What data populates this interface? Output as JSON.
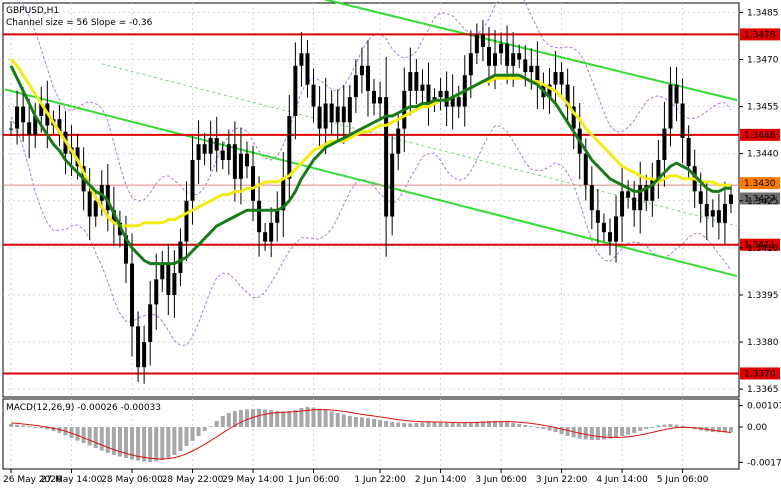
{
  "chart_data": {
    "type": "line",
    "symbol_label": "GBPUSD,H1",
    "channel_label": "Channel size = 56 Slope = -0.36",
    "macd_label": "MACD(12,26,9) -0.00026 -0.00033",
    "price_axis": {
      "ticks": [
        "1.3485",
        "1.3470",
        "1.3455",
        "1.3440",
        "1.3425",
        "1.3410",
        "1.3395",
        "1.3380",
        "1.3365"
      ],
      "tick_values": [
        1.3485,
        1.347,
        1.3455,
        1.344,
        1.3425,
        1.341,
        1.3395,
        1.338,
        1.3365
      ],
      "ylim": [
        1.33625,
        1.3488
      ]
    },
    "macd_axis": {
      "ticks": [
        "0.00107",
        "0.00",
        "-0.00177"
      ],
      "tick_values": [
        0.00107,
        0.0,
        -0.00177
      ],
      "ylim": [
        -0.0021,
        0.0014
      ]
    },
    "time_labels": [
      "26 May 2026",
      "27 May 14:00",
      "28 May 06:00",
      "28 May 22:00",
      "29 May 14:00",
      "1 Jun 06:00",
      "1 Jun 22:00",
      "2 Jun 14:00",
      "3 Jun 06:00",
      "3 Jun 22:00",
      "4 Jun 14:00",
      "5 Jun 06:00"
    ],
    "levels": [
      {
        "label": "1.3478",
        "value": 1.3478
      },
      {
        "label": "1.3446",
        "value": 1.3446
      },
      {
        "label": "1.3411",
        "value": 1.3411
      },
      {
        "label": "1.3370",
        "value": 1.337
      }
    ],
    "current_levels": [
      {
        "label": "1.3430",
        "value": 1.343
      },
      {
        "label": "1.3427",
        "value": 1.3427
      }
    ],
    "closes": [
      1.3448,
      1.3455,
      1.345,
      1.3446,
      1.3452,
      1.3456,
      1.3449,
      1.3451,
      1.3447,
      1.344,
      1.3442,
      1.3436,
      1.3428,
      1.342,
      1.3425,
      1.343,
      1.3422,
      1.3418,
      1.3414,
      1.3405,
      1.3385,
      1.3372,
      1.338,
      1.3392,
      1.34,
      1.3405,
      1.3395,
      1.3402,
      1.3412,
      1.3425,
      1.3438,
      1.3443,
      1.344,
      1.3445,
      1.3441,
      1.3438,
      1.3443,
      1.3432,
      1.344,
      1.3436,
      1.3425,
      1.3415,
      1.3412,
      1.3418,
      1.3422,
      1.3432,
      1.3452,
      1.3468,
      1.3472,
      1.3462,
      1.3455,
      1.3448,
      1.3456,
      1.345,
      1.3455,
      1.345,
      1.3458,
      1.3465,
      1.3468,
      1.346,
      1.3456,
      1.3458,
      1.342,
      1.344,
      1.3448,
      1.346,
      1.3466,
      1.346,
      1.3462,
      1.3456,
      1.3458,
      1.346,
      1.3455,
      1.3458,
      1.3455,
      1.3465,
      1.3472,
      1.3478,
      1.3474,
      1.3468,
      1.3472,
      1.3475,
      1.3468,
      1.3472,
      1.347,
      1.3466,
      1.3468,
      1.3462,
      1.3458,
      1.3462,
      1.3466,
      1.3462,
      1.3455,
      1.3448,
      1.344,
      1.343,
      1.3422,
      1.3418,
      1.3415,
      1.3412,
      1.342,
      1.3428,
      1.3426,
      1.3422,
      1.343,
      1.3425,
      1.3432,
      1.3438,
      1.3448,
      1.3462,
      1.3456,
      1.3445,
      1.3436,
      1.3428,
      1.3424,
      1.342,
      1.3422,
      1.3418,
      1.3424,
      1.3427
    ],
    "series": [
      {
        "values": [
          1.347,
          1.3468,
          1.3465,
          1.3462,
          1.3459,
          1.3456,
          1.3453,
          1.345,
          1.3447,
          1.3444,
          1.3441,
          1.3438,
          1.3434,
          1.343,
          1.3426,
          1.3423,
          1.342,
          1.3418,
          1.3417,
          1.3417,
          1.3417,
          1.3417,
          1.3418,
          1.3418,
          1.3418,
          1.3418,
          1.3419,
          1.3419,
          1.342,
          1.3421,
          1.3422,
          1.3423,
          1.3424,
          1.3425,
          1.3426,
          1.3427,
          1.3427,
          1.3428,
          1.3428,
          1.3429,
          1.3429,
          1.343,
          1.3431,
          1.3431,
          1.3431,
          1.3432,
          1.3433,
          1.3435,
          1.3437,
          1.3439,
          1.3441,
          1.3442,
          1.3443,
          1.3444,
          1.3444,
          1.3444,
          1.3445,
          1.3446,
          1.3447,
          1.3447,
          1.3448,
          1.3449,
          1.3449,
          1.345,
          1.3451,
          1.3452,
          1.3453,
          1.3454,
          1.3455,
          1.3455,
          1.3456,
          1.3457,
          1.3457,
          1.3458,
          1.3459,
          1.346,
          1.3461,
          1.3462,
          1.3463,
          1.3463,
          1.3464,
          1.3464,
          1.3464,
          1.3464,
          1.3464,
          1.3464,
          1.3463,
          1.3463,
          1.3462,
          1.3461,
          1.346,
          1.3458,
          1.3456,
          1.3453,
          1.3451,
          1.3448,
          1.3446,
          1.3444,
          1.3442,
          1.344,
          1.3438,
          1.3436,
          1.3435,
          1.3434,
          1.3433,
          1.3432,
          1.3432,
          1.3431,
          1.3432,
          1.3433,
          1.3433,
          1.3432,
          1.3432,
          1.3432,
          1.3431,
          1.3431,
          1.3431,
          1.343,
          1.343,
          1.343
        ],
        "color": "#f5ea12"
      },
      {
        "values": [
          1.3468,
          1.3464,
          1.346,
          1.3456,
          1.3452,
          1.3449,
          1.3446,
          1.3443,
          1.3441,
          1.3438,
          1.3436,
          1.3434,
          1.3432,
          1.343,
          1.3428,
          1.3427,
          1.3425,
          1.3421,
          1.3417,
          1.3413,
          1.341,
          1.3408,
          1.3406,
          1.3405,
          1.3405,
          1.3405,
          1.3405,
          1.3405,
          1.3406,
          1.3407,
          1.3409,
          1.3411,
          1.3413,
          1.3415,
          1.3417,
          1.3418,
          1.3419,
          1.342,
          1.3421,
          1.3422,
          1.3422,
          1.3422,
          1.3422,
          1.3422,
          1.3422,
          1.3423,
          1.3425,
          1.3428,
          1.3432,
          1.3435,
          1.3438,
          1.344,
          1.3442,
          1.3443,
          1.3444,
          1.3445,
          1.3446,
          1.3447,
          1.3448,
          1.3449,
          1.345,
          1.3451,
          1.3452,
          1.3452,
          1.3453,
          1.3454,
          1.3455,
          1.3455,
          1.3456,
          1.3456,
          1.3457,
          1.3457,
          1.3457,
          1.3458,
          1.3459,
          1.346,
          1.3461,
          1.3462,
          1.3463,
          1.3464,
          1.3465,
          1.3465,
          1.3465,
          1.3465,
          1.3465,
          1.3464,
          1.3463,
          1.3462,
          1.346,
          1.3458,
          1.3456,
          1.3453,
          1.345,
          1.3447,
          1.3444,
          1.3441,
          1.3438,
          1.3436,
          1.3434,
          1.3432,
          1.3431,
          1.343,
          1.3429,
          1.3428,
          1.3428,
          1.3429,
          1.343,
          1.3432,
          1.3434,
          1.3436,
          1.3437,
          1.3436,
          1.3435,
          1.3433,
          1.3431,
          1.3429,
          1.3428,
          1.3428,
          1.3429,
          1.3429
        ],
        "color": "#1a7a1a"
      }
    ],
    "channel_lines": [
      {
        "color": "#33dd33",
        "points": [
          [
            0,
            1.346
          ],
          [
            118,
            1.3402
          ]
        ]
      },
      {
        "color": "#33dd33",
        "points": [
          [
            50,
            1.349
          ],
          [
            118,
            1.3458
          ]
        ]
      }
    ],
    "macd_hist": [
      0.00015,
      0.00012,
      8e-05,
      4e-05,
      0.0,
      -5e-05,
      -0.00012,
      -0.0002,
      -0.0003,
      -0.00042,
      -0.00055,
      -0.00068,
      -0.0008,
      -0.00092,
      -0.00105,
      -0.00118,
      -0.0013,
      -0.0014,
      -0.00148,
      -0.00155,
      -0.00162,
      -0.00168,
      -0.00172,
      -0.00175,
      -0.00172,
      -0.00165,
      -0.00155,
      -0.0014,
      -0.0012,
      -0.00095,
      -0.0007,
      -0.00045,
      -0.0002,
      5e-05,
      0.0003,
      0.00055,
      0.0007,
      0.0008,
      0.00085,
      0.00088,
      0.0009,
      0.0009,
      0.00088,
      0.00085,
      0.0008,
      0.00078,
      0.0008,
      0.00085,
      0.00095,
      0.001,
      0.00098,
      0.00092,
      0.00085,
      0.00078,
      0.0007,
      0.00062,
      0.00055,
      0.0005,
      0.00048,
      0.00045,
      0.0004,
      0.00035,
      0.0003,
      0.00025,
      0.00022,
      0.0002,
      0.00018,
      0.0002,
      0.00022,
      0.00025,
      0.00025,
      0.00022,
      0.0002,
      0.0002,
      0.00018,
      0.0002,
      0.00022,
      0.00025,
      0.00028,
      0.0003,
      0.0003,
      0.00028,
      0.00025,
      0.0002,
      0.00015,
      0.0001,
      5e-05,
      -2e-05,
      -0.0001,
      -0.00018,
      -0.00025,
      -0.00035,
      -0.00045,
      -0.00052,
      -0.00058,
      -0.00062,
      -0.00065,
      -0.00065,
      -0.00062,
      -0.00058,
      -0.00052,
      -0.00045,
      -0.00038,
      -0.0003,
      -0.0002,
      -0.0001,
      0.0,
      8e-05,
      0.00012,
      0.00015,
      0.00012,
      5e-05,
      -5e-05,
      -0.00012,
      -0.00018,
      -0.00022,
      -0.00025,
      -0.00026,
      -0.00027,
      -0.00026
    ],
    "macd_signal": [
      0.0002,
      0.00018,
      0.00015,
      0.00012,
      8e-05,
      4e-05,
      -1e-05,
      -6e-05,
      -0.00013,
      -0.00021,
      -0.00031,
      -0.00042,
      -0.00054,
      -0.00066,
      -0.00078,
      -0.0009,
      -0.00102,
      -0.00113,
      -0.00123,
      -0.00132,
      -0.0014,
      -0.00147,
      -0.00152,
      -0.00156,
      -0.00159,
      -0.0016,
      -0.00158,
      -0.00153,
      -0.00145,
      -0.00134,
      -0.0012,
      -0.00104,
      -0.00087,
      -0.00068,
      -0.00049,
      -0.00029,
      -0.0001,
      8e-05,
      0.00024,
      0.00037,
      0.00048,
      0.00057,
      0.00064,
      0.00069,
      0.00072,
      0.00074,
      0.00075,
      0.00077,
      0.0008,
      0.00083,
      0.00086,
      0.00087,
      0.00087,
      0.00085,
      0.00082,
      0.00078,
      0.00073,
      0.00068,
      0.00063,
      0.00059,
      0.00055,
      0.0005,
      0.00046,
      0.00041,
      0.00037,
      0.00033,
      0.0003,
      0.00028,
      0.00026,
      0.00026,
      0.00025,
      0.00025,
      0.00024,
      0.00023,
      0.00022,
      0.00022,
      0.00022,
      0.00023,
      0.00024,
      0.00025,
      0.00026,
      0.00027,
      0.00027,
      0.00026,
      0.00024,
      0.00021,
      0.00018,
      0.00014,
      9e-05,
      3e-05,
      -3e-05,
      -0.0001,
      -0.00017,
      -0.00024,
      -0.00031,
      -0.00037,
      -0.00043,
      -0.00047,
      -0.0005,
      -0.00052,
      -0.00052,
      -0.00051,
      -0.00049,
      -0.00045,
      -0.0004,
      -0.00034,
      -0.00027,
      -0.0002,
      -0.00013,
      -7e-05,
      -3e-05,
      -1e-05,
      -2e-05,
      -4e-05,
      -7e-05,
      -0.00011,
      -0.00016,
      -0.0002,
      -0.00024,
      -0.00028
    ]
  }
}
